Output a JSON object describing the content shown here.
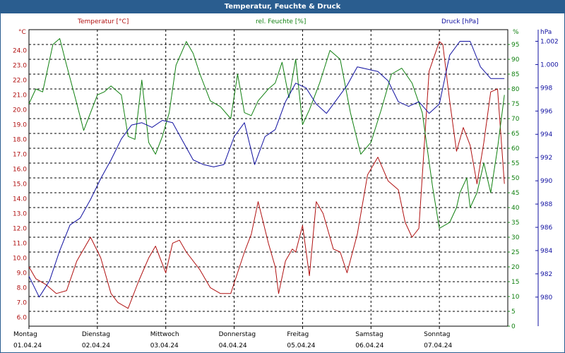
{
  "window": {
    "title": "Temperatur, Feuchte & Druck"
  },
  "colors": {
    "temperature": "#b01010",
    "humidity": "#108010",
    "pressure": "#1010a0",
    "frame": "#2a5d8f"
  },
  "chart_data": {
    "type": "line",
    "title": "Temperatur, Feuchte & Druck",
    "grid": true,
    "x": {
      "range": [
        0,
        7
      ],
      "day_ticks": [
        {
          "day": "Montag",
          "date": "01.04.24"
        },
        {
          "day": "Dienstag",
          "date": "02.04.24"
        },
        {
          "day": "Mittwoch",
          "date": "03.04.24"
        },
        {
          "day": "Donnerstag",
          "date": "04.04.24"
        },
        {
          "day": "Freitag",
          "date": "05.04.24"
        },
        {
          "day": "Samstag",
          "date": "06.04.24"
        },
        {
          "day": "Sonntag",
          "date": "07.04.24"
        }
      ]
    },
    "axes": {
      "temperature": {
        "title": "Temperatur [°C]",
        "unit": "°C",
        "ylim": [
          5.4,
          25.4
        ],
        "ticks": [
          6.0,
          7.0,
          8.0,
          9.0,
          10.0,
          11.0,
          12.0,
          13.0,
          14.0,
          15.0,
          16.0,
          17.0,
          18.0,
          19.0,
          20.0,
          21.0,
          22.0,
          23.0,
          24.0
        ]
      },
      "humidity": {
        "title": "rel. Feuchte [%]",
        "unit": "%",
        "ylim": [
          0,
          100
        ],
        "ticks": [
          0,
          5,
          10,
          15,
          20,
          25,
          30,
          35,
          40,
          45,
          50,
          55,
          60,
          65,
          70,
          75,
          80,
          85,
          90,
          95
        ]
      },
      "pressure": {
        "title": "Druck [hPa]",
        "unit": "hPa",
        "ylim": [
          977.5,
          1003.0
        ],
        "ticks": [
          980,
          982,
          984,
          986,
          988,
          990,
          992,
          994,
          996,
          998,
          "1.000",
          "1.002"
        ]
      }
    },
    "series": [
      {
        "name": "Temperatur [°C]",
        "axis": "temperature",
        "color": "#b01010",
        "x": [
          0,
          0.1,
          0.25,
          0.4,
          0.55,
          0.7,
          0.9,
          1.05,
          1.2,
          1.3,
          1.45,
          1.6,
          1.75,
          1.85,
          1.9,
          2.0,
          2.1,
          2.2,
          2.3,
          2.5,
          2.65,
          2.8,
          2.95,
          3.05,
          3.15,
          3.25,
          3.35,
          3.5,
          3.6,
          3.65,
          3.75,
          3.85,
          3.9,
          4.0,
          4.1,
          4.2,
          4.3,
          4.45,
          4.55,
          4.65,
          4.8,
          4.95,
          5.1,
          5.25,
          5.4,
          5.5,
          5.6,
          5.7,
          5.85,
          6.0,
          6.05,
          6.15,
          6.25,
          6.35,
          6.45,
          6.55,
          6.65,
          6.75,
          6.85,
          6.95
        ],
        "values": [
          9.4,
          8.6,
          8.2,
          7.6,
          7.8,
          9.8,
          11.4,
          10.0,
          7.6,
          7.0,
          6.6,
          8.4,
          10.0,
          10.8,
          10.2,
          9.0,
          11.0,
          11.2,
          10.4,
          9.2,
          8.0,
          7.6,
          7.6,
          9.0,
          10.4,
          11.6,
          13.8,
          11.0,
          9.4,
          7.6,
          9.8,
          10.6,
          10.4,
          12.2,
          8.8,
          13.8,
          13.0,
          10.6,
          10.4,
          9.0,
          11.6,
          15.6,
          16.8,
          15.2,
          14.6,
          12.4,
          11.4,
          12.0,
          22.6,
          24.6,
          24.4,
          20.6,
          17.2,
          18.8,
          17.6,
          15.0,
          17.8,
          21.2,
          21.4,
          15.0
        ]
      },
      {
        "name": "rel. Feuchte [%]",
        "axis": "humidity",
        "color": "#108010",
        "x": [
          0,
          0.1,
          0.2,
          0.35,
          0.45,
          0.55,
          0.7,
          0.8,
          0.9,
          1.0,
          1.1,
          1.2,
          1.35,
          1.45,
          1.55,
          1.65,
          1.75,
          1.85,
          1.95,
          2.05,
          2.15,
          2.3,
          2.4,
          2.5,
          2.65,
          2.8,
          2.95,
          3.05,
          3.15,
          3.25,
          3.35,
          3.5,
          3.6,
          3.7,
          3.8,
          3.9,
          4.0,
          4.1,
          4.25,
          4.4,
          4.55,
          4.7,
          4.85,
          5.0,
          5.15,
          5.3,
          5.45,
          5.6,
          5.75,
          5.9,
          6.0,
          6.15,
          6.25,
          6.3,
          6.4,
          6.45,
          6.55,
          6.65,
          6.75,
          6.85,
          6.95
        ],
        "values": [
          75,
          80,
          79,
          95,
          97,
          88,
          75,
          66,
          72,
          78,
          79,
          81,
          78,
          64,
          63,
          83,
          62,
          58,
          64,
          72,
          88,
          96,
          92,
          85,
          76,
          74,
          70,
          85,
          72,
          71,
          76,
          80,
          82,
          89,
          77,
          90,
          68,
          73,
          82,
          93,
          90,
          72,
          58,
          62,
          73,
          85,
          87,
          82,
          72,
          47,
          33,
          35,
          40,
          45,
          50,
          40,
          45,
          55,
          45,
          60,
          78
        ]
      },
      {
        "name": "Druck [hPa]",
        "axis": "pressure",
        "color": "#1010a0",
        "x": [
          0,
          0.15,
          0.3,
          0.45,
          0.6,
          0.75,
          0.9,
          1.05,
          1.2,
          1.35,
          1.5,
          1.65,
          1.8,
          1.95,
          2.1,
          2.25,
          2.4,
          2.55,
          2.7,
          2.85,
          3.0,
          3.15,
          3.3,
          3.45,
          3.6,
          3.75,
          3.9,
          4.05,
          4.2,
          4.35,
          4.5,
          4.65,
          4.8,
          4.95,
          5.1,
          5.25,
          5.4,
          5.55,
          5.7,
          5.85,
          6.0,
          6.15,
          6.3,
          6.45,
          6.6,
          6.75,
          6.95
        ],
        "values": [
          981.8,
          980.0,
          981.4,
          984.0,
          986.2,
          986.8,
          988.4,
          990.2,
          991.8,
          993.6,
          994.8,
          995.0,
          994.6,
          995.2,
          995.0,
          993.4,
          991.8,
          991.4,
          991.2,
          991.4,
          993.8,
          995.0,
          991.4,
          993.8,
          994.4,
          996.8,
          998.4,
          998.0,
          996.6,
          995.8,
          997.0,
          998.2,
          999.8,
          999.6,
          999.4,
          998.6,
          996.8,
          996.4,
          996.8,
          995.8,
          996.6,
          1000.8,
          1002.0,
          1002.0,
          999.8,
          998.8,
          998.8
        ]
      }
    ]
  }
}
